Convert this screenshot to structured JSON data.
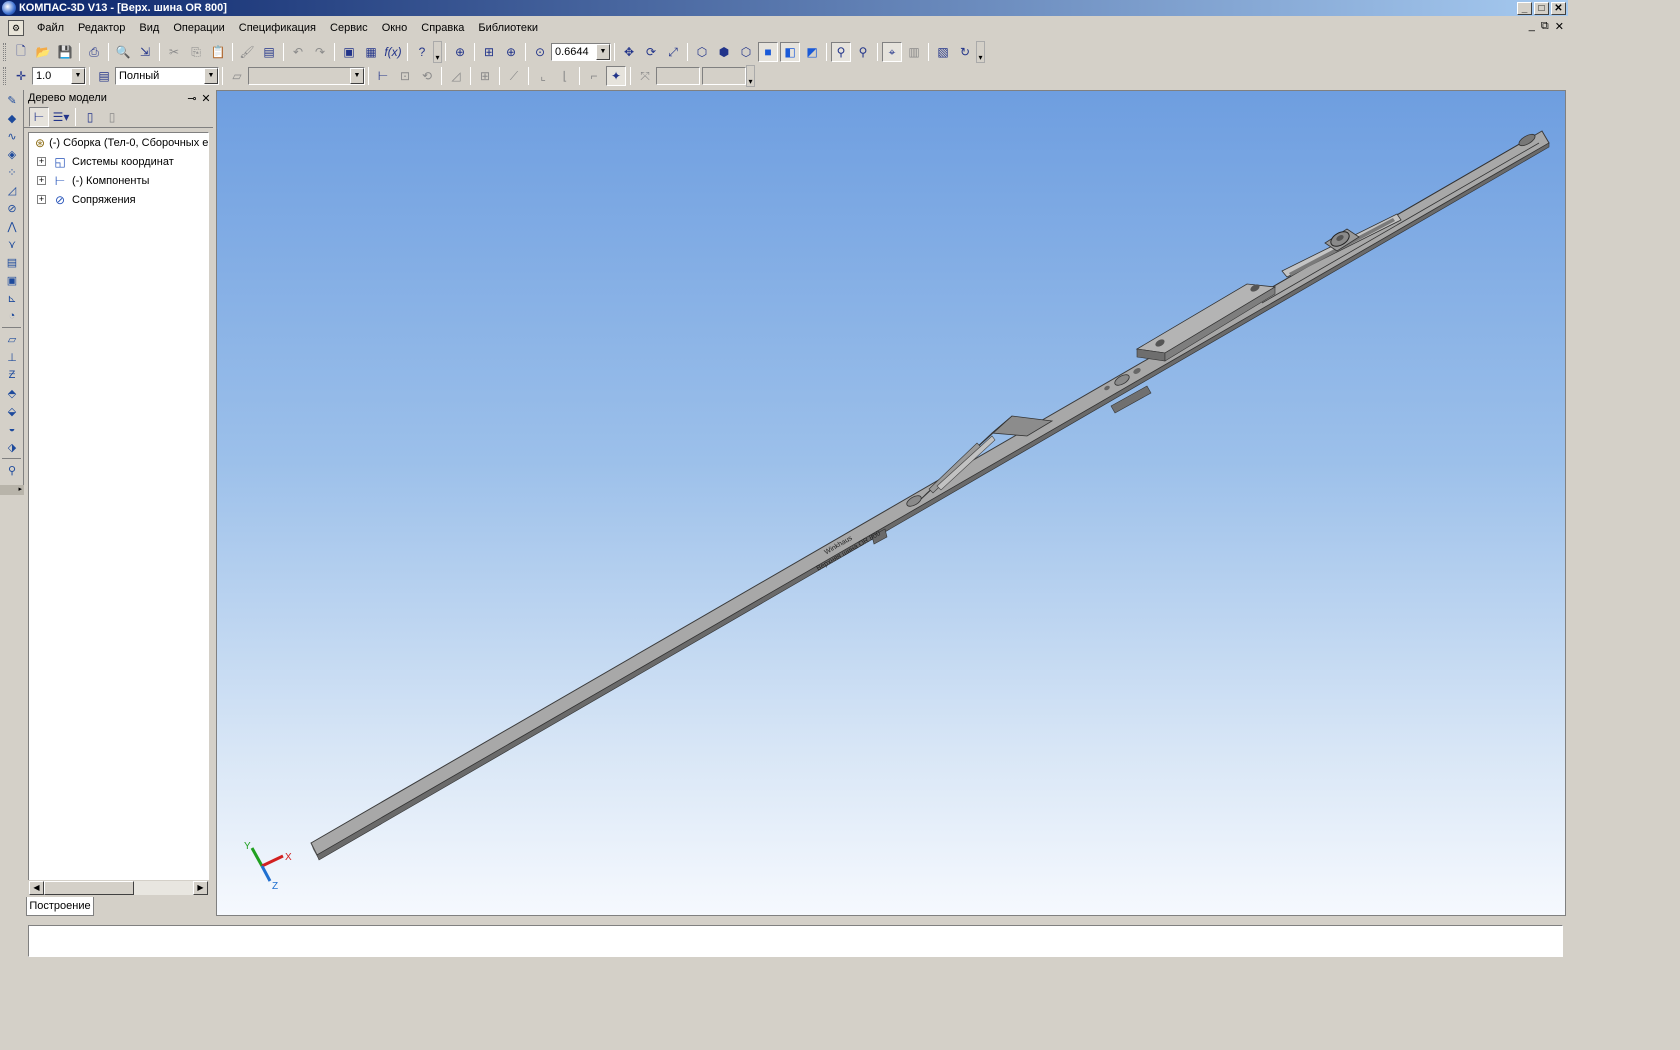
{
  "window": {
    "title": "КОМПАС-3D V13 - [Верх. шина OR 800]",
    "controls": {
      "minimize": "_",
      "maximize": "□",
      "close": "✕"
    }
  },
  "menu": {
    "items": [
      "Файл",
      "Редактор",
      "Вид",
      "Операции",
      "Спецификация",
      "Сервис",
      "Окно",
      "Справка",
      "Библиотеки"
    ],
    "mdi_controls": {
      "minimize": "_",
      "restore": "⧉",
      "close": "✕"
    }
  },
  "toolbar_view": {
    "zoom_value": "0.6644"
  },
  "toolbar_current": {
    "step_value": "1.0",
    "display_mode": "Полный",
    "layer_value": ""
  },
  "model_tree": {
    "panel_title": "Дерево модели",
    "root_label": "(-) Сборка (Тел-0, Сборочных е",
    "items": [
      {
        "label": "Системы координат"
      },
      {
        "label": "(-) Компоненты"
      },
      {
        "label": "Сопряжения"
      }
    ],
    "tab_label": "Построение"
  },
  "viewport": {
    "part_engraving_line1": "Winkhaus",
    "part_engraving_line2": "Верхняя шина OR 800",
    "triad": {
      "x": "X",
      "y": "Y",
      "z": "Z"
    }
  },
  "status": {
    "text": ""
  },
  "colors": {
    "title_gradient_start": "#0a246a",
    "title_gradient_end": "#a6caf0",
    "viewport_top": "#6e9ee0",
    "viewport_bottom": "#f6f9fe",
    "part_face": "#a9a9a9",
    "axis_x": "#d22020",
    "axis_y": "#20a020",
    "axis_z": "#2070d0"
  }
}
